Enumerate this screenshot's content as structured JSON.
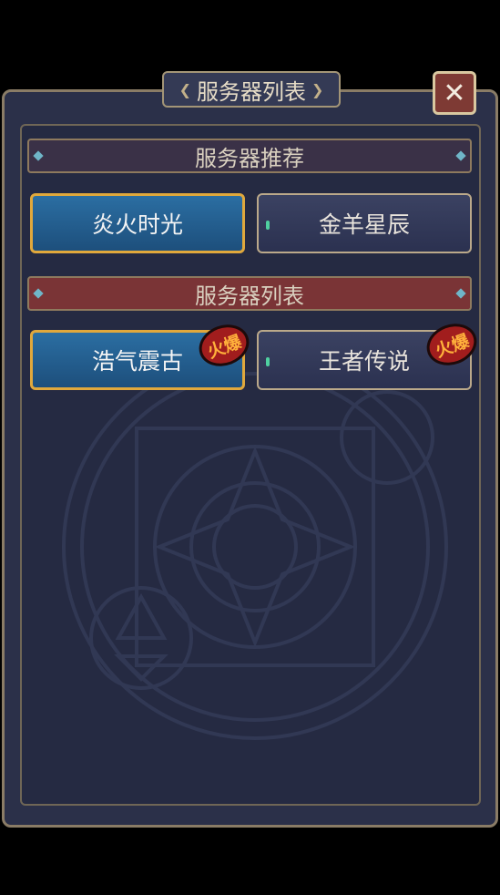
{
  "title": "服务器列表",
  "sections": {
    "recommended": {
      "label": "服务器推荐"
    },
    "list": {
      "label": "服务器列表"
    }
  },
  "recommended_servers": [
    {
      "name": "炎火时光",
      "state": "selected"
    },
    {
      "name": "金羊星辰",
      "state": "normal"
    }
  ],
  "list_servers": [
    {
      "name": "浩气震古",
      "state": "selected",
      "badge": "火爆"
    },
    {
      "name": "王者传说",
      "state": "normal",
      "badge": "火爆"
    }
  ],
  "close_icon": "close-icon",
  "colors": {
    "accent": "#e0a83c",
    "panel": "#2b3049",
    "hot": "#a11d1d"
  }
}
